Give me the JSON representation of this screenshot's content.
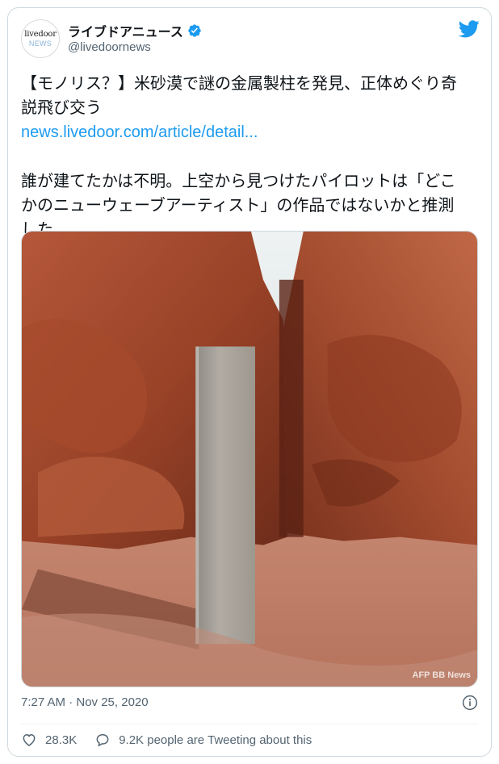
{
  "account": {
    "avatar_line1": "livedoor",
    "avatar_line2": "NEWS",
    "display_name": "ライブドアニュース",
    "handle": "@livedoornews"
  },
  "tweet": {
    "headline": "【モノリス？】米砂漠で謎の金属製柱を発見、正体めぐり奇\n説飛び交う",
    "link": "news.livedoor.com/article/detail...",
    "body": "誰が建てたかは不明。上空から見つけたパイロットは「どこ\nかのニューウェーブアーティスト」の作品ではないかと推測\nした。",
    "image_watermark": "AFP BB News",
    "timestamp": "7:27 AM · Nov 25, 2020"
  },
  "engagement": {
    "likes": "28.3K",
    "tweeting_about": "9.2K people are Tweeting about this"
  },
  "colors": {
    "link_blue": "#1d9bf0",
    "twitter_blue": "#1d9bf0",
    "secondary_text": "#536471",
    "border": "#cfd9de"
  },
  "icons": {
    "verified": "verified-badge-icon",
    "logo": "twitter-bird-icon",
    "info": "info-icon",
    "like": "heart-icon",
    "reply": "speech-bubble-icon"
  }
}
